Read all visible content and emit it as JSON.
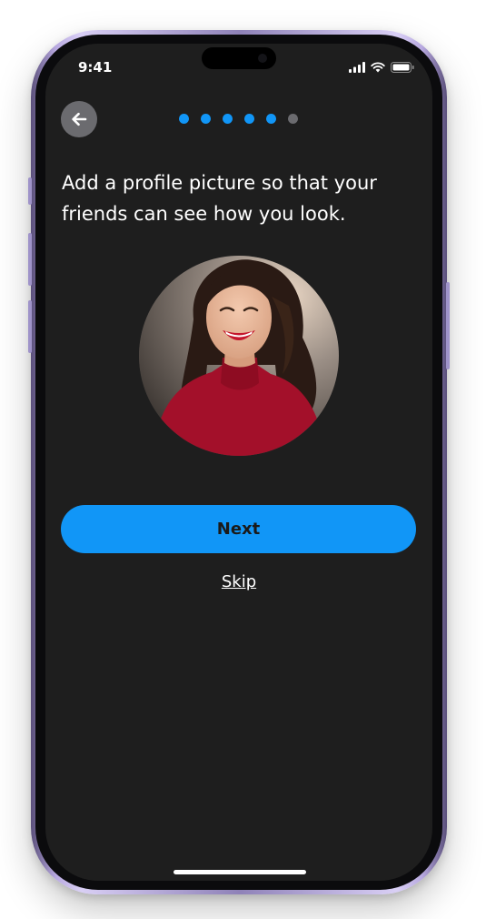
{
  "status_bar": {
    "time": "9:41",
    "icons": [
      "signal-icon",
      "wifi-icon",
      "battery-icon"
    ]
  },
  "header": {
    "back_icon": "arrow-left-icon",
    "progress": {
      "total_steps": 6,
      "completed_steps": 5,
      "active_color": "#1196f7",
      "inactive_color": "#6b6b6f"
    }
  },
  "main": {
    "heading": "Add a profile picture so that your friends can see how you look.",
    "avatar_alt": "profile-photo"
  },
  "actions": {
    "next_label": "Next",
    "skip_label": "Skip"
  },
  "colors": {
    "background": "#1e1e1e",
    "primary": "#1196f7",
    "text": "#ffffff"
  }
}
